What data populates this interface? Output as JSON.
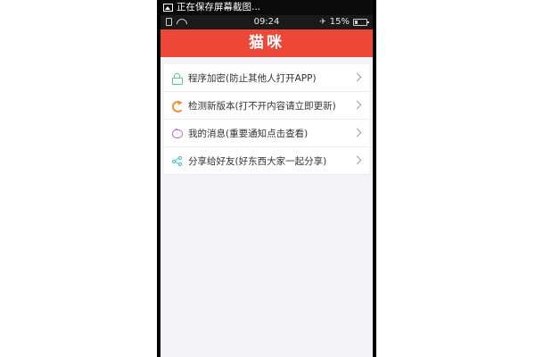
{
  "notification": {
    "text": "正在保存屏幕截图..."
  },
  "status_bar": {
    "time": "09:24",
    "battery": "15%"
  },
  "header": {
    "title": "猫咪"
  },
  "menu": {
    "items": [
      {
        "label": "程序加密(防止其他人打开APP)",
        "icon": "lock-icon"
      },
      {
        "label": "检测新版本(打不开内容请立即更新)",
        "icon": "refresh-icon"
      },
      {
        "label": "我的消息(重要通知点击查看)",
        "icon": "message-icon"
      },
      {
        "label": "分享给好友(好东西大家一起分享)",
        "icon": "share-icon"
      }
    ]
  },
  "colors": {
    "header_bg": "#ec4737",
    "lock": "#5cc98e",
    "refresh": "#f0913a",
    "message": "#b266d6",
    "share": "#3bbfcf"
  }
}
